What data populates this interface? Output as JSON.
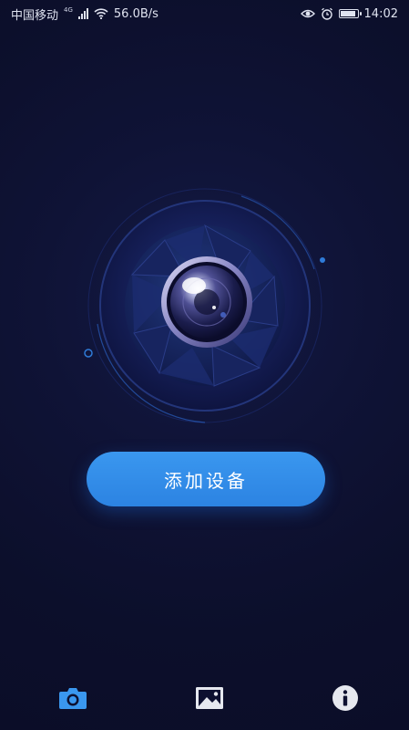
{
  "status_bar": {
    "carrier": "中国移动",
    "network_badge": "4G",
    "speed": "56.0B/s",
    "time": "14:02",
    "battery_level": 0.8
  },
  "main": {
    "add_device_label": "添加设备"
  },
  "bottom_nav": {
    "items": [
      {
        "icon": "camera-icon",
        "active": true
      },
      {
        "icon": "image-icon",
        "active": false
      },
      {
        "icon": "info-icon",
        "active": false
      }
    ]
  },
  "colors": {
    "background": "#0d1030",
    "accent": "#3a97ef",
    "nav_active": "#3a97ef",
    "nav_inactive": "#e6e8ef"
  }
}
